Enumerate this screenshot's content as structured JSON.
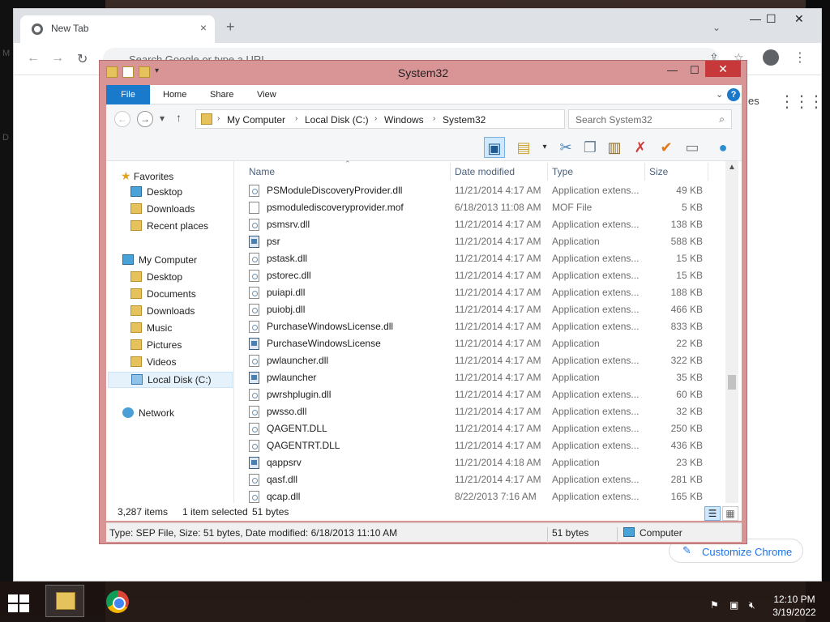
{
  "chrome": {
    "tab_title": "New Tab",
    "tab_close": "×",
    "new_tab": "+",
    "tab_dropdown": "⌄",
    "minimize": "—",
    "maximize": "☐",
    "close": "✕",
    "back": "←",
    "forward": "→",
    "reload": "↻",
    "omnibox_placeholder": "Search Google or type a URL",
    "side_text": "es",
    "customize_label": "Customize Chrome",
    "edge_letters": [
      "M",
      "D"
    ]
  },
  "explorer": {
    "title": "System32",
    "minimize": "—",
    "maximize": "☐",
    "close": "✕",
    "ribbon_tabs": [
      "File",
      "Home",
      "Share",
      "View"
    ],
    "breadcrumbs": [
      "My Computer",
      "Local Disk (C:)",
      "Windows",
      "System32"
    ],
    "search_placeholder": "Search System32",
    "nav_pane": {
      "favorites_header": "Favorites",
      "favorites": [
        "Desktop",
        "Downloads",
        "Recent places"
      ],
      "computer_header": "My Computer",
      "computer_items": [
        "Desktop",
        "Documents",
        "Downloads",
        "Music",
        "Pictures",
        "Videos",
        "Local Disk (C:)"
      ],
      "network": "Network"
    },
    "columns": [
      "Name",
      "Date modified",
      "Type",
      "Size"
    ],
    "files": [
      {
        "name": "PSModuleDiscoveryProvider.dll",
        "date": "11/21/2014 4:17 AM",
        "type": "Application extens...",
        "size": "49 KB",
        "icon": "dll"
      },
      {
        "name": "psmodulediscoveryprovider.mof",
        "date": "6/18/2013 11:08 AM",
        "type": "MOF File",
        "size": "5 KB",
        "icon": "file"
      },
      {
        "name": "psmsrv.dll",
        "date": "11/21/2014 4:17 AM",
        "type": "Application extens...",
        "size": "138 KB",
        "icon": "dll"
      },
      {
        "name": "psr",
        "date": "11/21/2014 4:17 AM",
        "type": "Application",
        "size": "588 KB",
        "icon": "app"
      },
      {
        "name": "pstask.dll",
        "date": "11/21/2014 4:17 AM",
        "type": "Application extens...",
        "size": "15 KB",
        "icon": "dll"
      },
      {
        "name": "pstorec.dll",
        "date": "11/21/2014 4:17 AM",
        "type": "Application extens...",
        "size": "15 KB",
        "icon": "dll"
      },
      {
        "name": "puiapi.dll",
        "date": "11/21/2014 4:17 AM",
        "type": "Application extens...",
        "size": "188 KB",
        "icon": "dll"
      },
      {
        "name": "puiobj.dll",
        "date": "11/21/2014 4:17 AM",
        "type": "Application extens...",
        "size": "466 KB",
        "icon": "dll"
      },
      {
        "name": "PurchaseWindowsLicense.dll",
        "date": "11/21/2014 4:17 AM",
        "type": "Application extens...",
        "size": "833 KB",
        "icon": "dll"
      },
      {
        "name": "PurchaseWindowsLicense",
        "date": "11/21/2014 4:17 AM",
        "type": "Application",
        "size": "22 KB",
        "icon": "app"
      },
      {
        "name": "pwlauncher.dll",
        "date": "11/21/2014 4:17 AM",
        "type": "Application extens...",
        "size": "322 KB",
        "icon": "dll"
      },
      {
        "name": "pwlauncher",
        "date": "11/21/2014 4:17 AM",
        "type": "Application",
        "size": "35 KB",
        "icon": "app"
      },
      {
        "name": "pwrshplugin.dll",
        "date": "11/21/2014 4:17 AM",
        "type": "Application extens...",
        "size": "60 KB",
        "icon": "dll"
      },
      {
        "name": "pwsso.dll",
        "date": "11/21/2014 4:17 AM",
        "type": "Application extens...",
        "size": "32 KB",
        "icon": "dll"
      },
      {
        "name": "QAGENT.DLL",
        "date": "11/21/2014 4:17 AM",
        "type": "Application extens...",
        "size": "250 KB",
        "icon": "dll"
      },
      {
        "name": "QAGENTRT.DLL",
        "date": "11/21/2014 4:17 AM",
        "type": "Application extens...",
        "size": "436 KB",
        "icon": "dll"
      },
      {
        "name": "qappsrv",
        "date": "11/21/2014 4:18 AM",
        "type": "Application",
        "size": "23 KB",
        "icon": "app"
      },
      {
        "name": "qasf.dll",
        "date": "11/21/2014 4:17 AM",
        "type": "Application extens...",
        "size": "281 KB",
        "icon": "dll"
      },
      {
        "name": "qcap.dll",
        "date": "8/22/2013 7:16 AM",
        "type": "Application extens...",
        "size": "165 KB",
        "icon": "dll"
      }
    ],
    "status": {
      "items": "3,287 items",
      "selected": "1 item selected",
      "selected_size": "51 bytes"
    },
    "details": {
      "info": "Type: SEP File, Size: 51 bytes, Date modified: 6/18/2013 11:10 AM",
      "size": "51 bytes",
      "location": "Computer"
    }
  },
  "taskbar": {
    "time": "12:10 PM",
    "date": "3/19/2022"
  },
  "colors": {
    "explorer_frame": "#d99496",
    "file_tab": "#1979ca",
    "close_button": "#c7383a"
  }
}
